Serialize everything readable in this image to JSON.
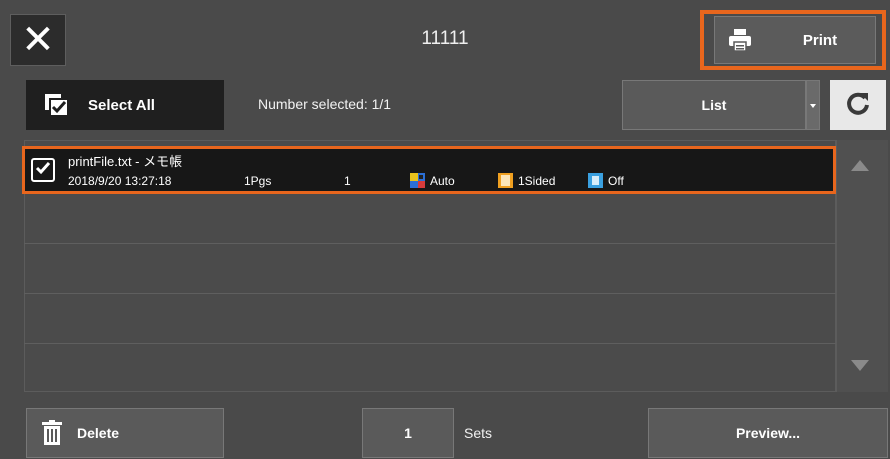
{
  "header": {
    "close_icon": "close-icon",
    "title": "11111",
    "print_label": "Print",
    "print_icon": "printer-icon"
  },
  "toolbar": {
    "select_all_label": "Select All",
    "number_selected": "Number selected: 1/1",
    "view_label": "List",
    "refresh_icon": "refresh-icon"
  },
  "jobs": [
    {
      "name": "printFile.txt - メモ帳",
      "date": "2018/9/20 13:27:18",
      "pages": "1Pgs",
      "copies": "1",
      "color": "Auto",
      "sided": "1Sided",
      "staple": "Off",
      "selected": true
    }
  ],
  "footer": {
    "delete_label": "Delete",
    "sets_value": "1",
    "sets_label": "Sets",
    "preview_label": "Preview..."
  },
  "colors": {
    "highlight": "#e8661d",
    "background": "#4a4a4a",
    "selected_row": "#171717"
  }
}
